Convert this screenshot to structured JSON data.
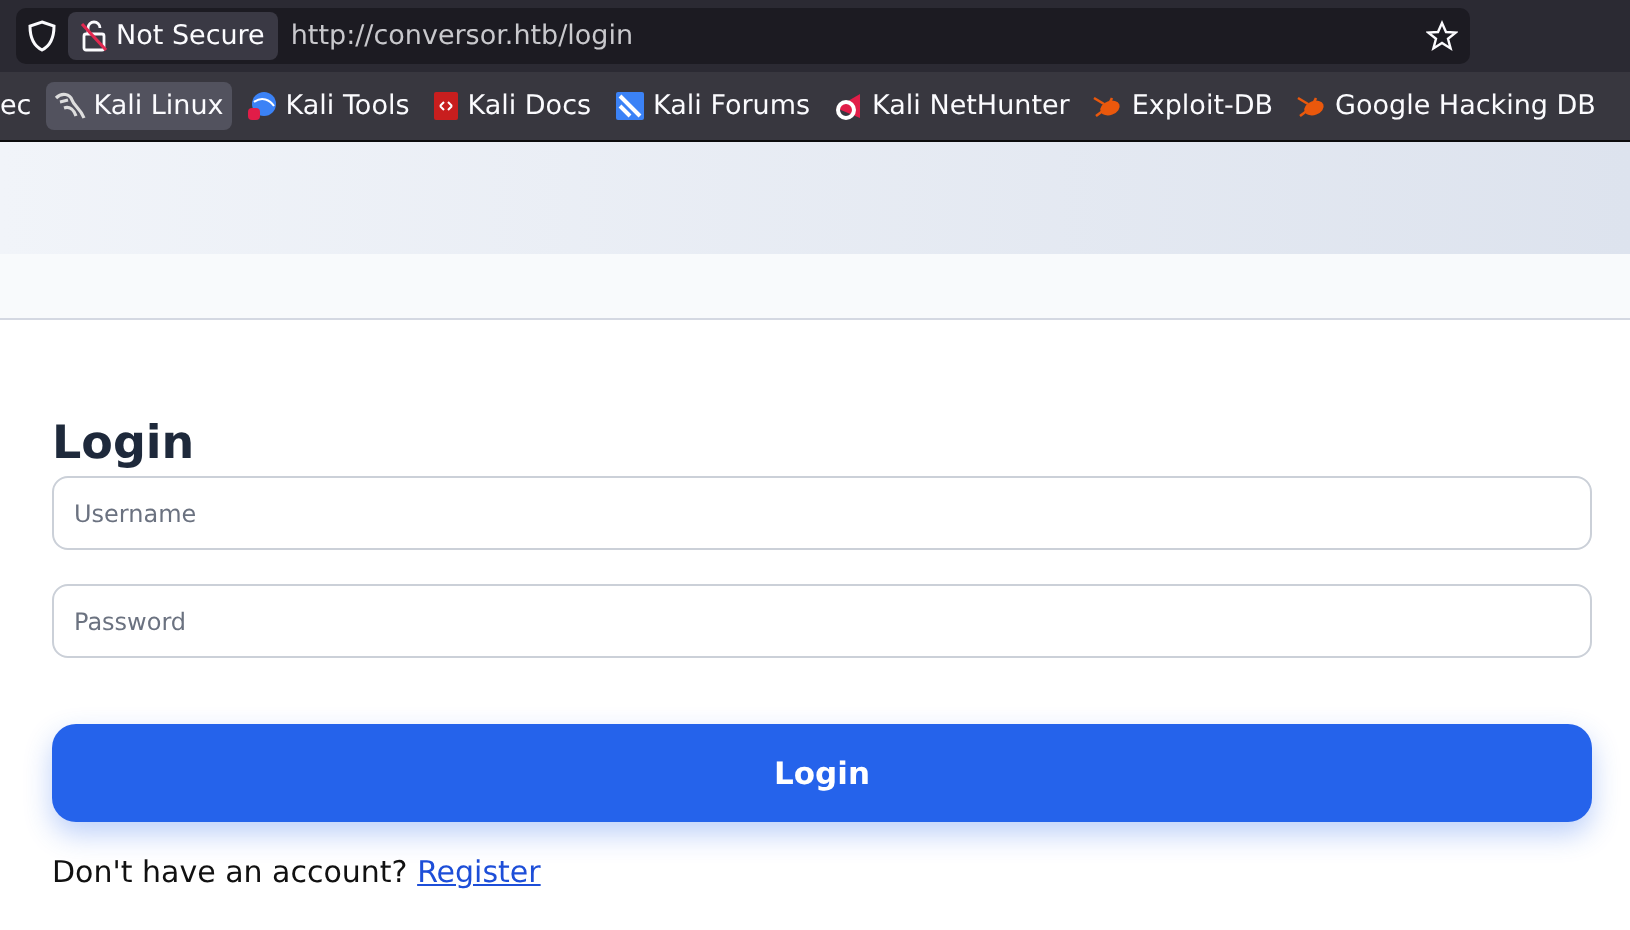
{
  "browser": {
    "security_label": "Not Secure",
    "url": "http://conversor.htb/login",
    "bookmarks": [
      {
        "label": "ec",
        "kind": "none",
        "selected": false
      },
      {
        "label": "Kali Linux",
        "kind": "dragon",
        "selected": true
      },
      {
        "label": "Kali Tools",
        "kind": "tools",
        "selected": false
      },
      {
        "label": "Kali Docs",
        "kind": "docs",
        "selected": false
      },
      {
        "label": "Kali Forums",
        "kind": "forums",
        "selected": false
      },
      {
        "label": "Kali NetHunter",
        "kind": "nethunter",
        "selected": false
      },
      {
        "label": "Exploit-DB",
        "kind": "bug",
        "selected": false
      },
      {
        "label": "Google Hacking DB",
        "kind": "bug",
        "selected": false
      }
    ]
  },
  "form": {
    "title": "Login",
    "fields": [
      {
        "placeholder": "Username"
      },
      {
        "placeholder": "Password"
      }
    ],
    "submit": "Login",
    "footer": {
      "text": "Don't have an account?",
      "link": "Register"
    }
  }
}
